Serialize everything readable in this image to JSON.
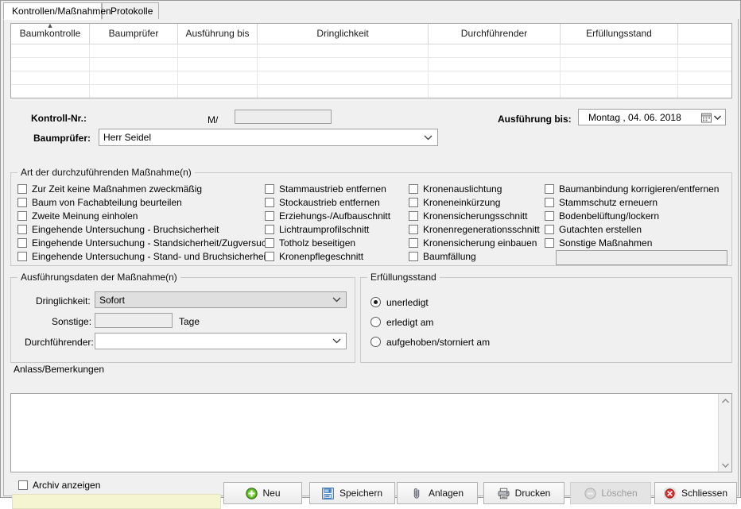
{
  "window": {
    "title": "Kontrollen/Maßnahmen"
  },
  "tabs": [
    {
      "label": "Kontrollen/Maßnahmen",
      "active": true
    },
    {
      "label": "Protokolle",
      "active": false
    }
  ],
  "grid": {
    "columns": [
      "Baumkontrolle",
      "Baumprüfer",
      "Ausführung bis",
      "Dringlichkeit",
      "Durchführender",
      "Erfüllungsstand",
      ""
    ],
    "sort_column": "Baumkontrolle",
    "sort_direction": "ascending",
    "rows": [],
    "empty_row_count": 4
  },
  "header_fields": {
    "kontroll_nr_label": "Kontroll-Nr.:",
    "kontroll_nr_prefix": "M/",
    "kontroll_nr_value": "",
    "baumpruefer_label": "Baumprüfer:",
    "baumpruefer_value": "Herr Seidel",
    "ausfuehrung_bis_label": "Ausführung bis:",
    "ausfuehrung_bis_value": "Montag    , 04. 06. 2018"
  },
  "massnahmen_group": {
    "title": "Art der durchzuführenden Maßnahme(n)",
    "column1": [
      {
        "label": "Zur Zeit keine Maßnahmen zweckmäßig",
        "checked": false
      },
      {
        "label": "Baum von Fachabteilung beurteilen",
        "checked": false
      },
      {
        "label": "Zweite Meinung einholen",
        "checked": false
      },
      {
        "label": "Eingehende Untersuchung - Bruchsicherheit",
        "checked": false
      },
      {
        "label": "Eingehende Untersuchung - Standsicherheit/Zugversuch",
        "checked": false
      },
      {
        "label": "Eingehende Untersuchung - Stand- und Bruchsicherheit",
        "checked": false
      }
    ],
    "column2": [
      {
        "label": "Stammaustrieb entfernen",
        "checked": false
      },
      {
        "label": "Stockaustrieb entfernen",
        "checked": false
      },
      {
        "label": "Erziehungs-/Aufbauschnitt",
        "checked": false
      },
      {
        "label": "Lichtraumprofilschnitt",
        "checked": false
      },
      {
        "label": "Totholz beseitigen",
        "checked": false
      },
      {
        "label": "Kronenpflegeschnitt",
        "checked": false
      }
    ],
    "column3": [
      {
        "label": "Kronenauslichtung",
        "checked": false
      },
      {
        "label": "Kroneneinkürzung",
        "checked": false
      },
      {
        "label": "Kronensicherungsschnitt",
        "checked": false
      },
      {
        "label": "Kronenregenerationsschnitt",
        "checked": false
      },
      {
        "label": "Kronensicherung einbauen",
        "checked": false
      },
      {
        "label": "Baumfällung",
        "checked": false
      }
    ],
    "column4": [
      {
        "label": "Baumanbindung korrigieren/entfernen",
        "checked": false
      },
      {
        "label": "Stammschutz erneuern",
        "checked": false
      },
      {
        "label": "Bodenbelüftung/lockern",
        "checked": false
      },
      {
        "label": "Gutachten erstellen",
        "checked": false
      },
      {
        "label": "Sonstige Maßnahmen",
        "checked": false
      }
    ],
    "sonstige_value": ""
  },
  "ausfuehrungsdaten": {
    "title": "Ausführungsdaten der Maßnahme(n)",
    "dringlichkeit_label": "Dringlichkeit:",
    "dringlichkeit_value": "Sofort",
    "sonstige_label": "Sonstige:",
    "sonstige_value": "",
    "tage_label": "Tage",
    "durchfuehrender_label": "Durchführender:",
    "durchfuehrender_value": ""
  },
  "erfuellungsstand": {
    "title": "Erfüllungsstand",
    "options": [
      {
        "label": "unerledigt",
        "selected": true
      },
      {
        "label": "erledigt am",
        "selected": false
      },
      {
        "label": "aufgehoben/storniert am",
        "selected": false
      }
    ]
  },
  "anlass": {
    "title": "Anlass/Bemerkungen",
    "value": ""
  },
  "footer": {
    "archiv_label": "Archiv anzeigen",
    "archiv_checked": false,
    "status_text": "",
    "buttons": [
      {
        "label": "Neu",
        "icon": "plus-circle-icon",
        "enabled": true
      },
      {
        "label": "Speichern",
        "icon": "save-disk-icon",
        "enabled": true
      },
      {
        "label": "Anlagen",
        "icon": "paperclip-icon",
        "enabled": true
      },
      {
        "label": "Drucken",
        "icon": "printer-icon",
        "enabled": true
      },
      {
        "label": "Löschen",
        "icon": "minus-circle-icon",
        "enabled": false
      },
      {
        "label": "Schliessen",
        "icon": "close-circle-icon",
        "enabled": true
      }
    ]
  },
  "colors": {
    "window_bg": "#f0f0f0",
    "field_bg": "#ffffff",
    "disabled_field_bg": "#ededed",
    "grayed_combo_bg": "#dfdfdf",
    "status_bg": "#f5f5d2",
    "accent_green": "#55b816",
    "accent_red": "#e03131",
    "accent_blue": "#2b6cb0"
  }
}
